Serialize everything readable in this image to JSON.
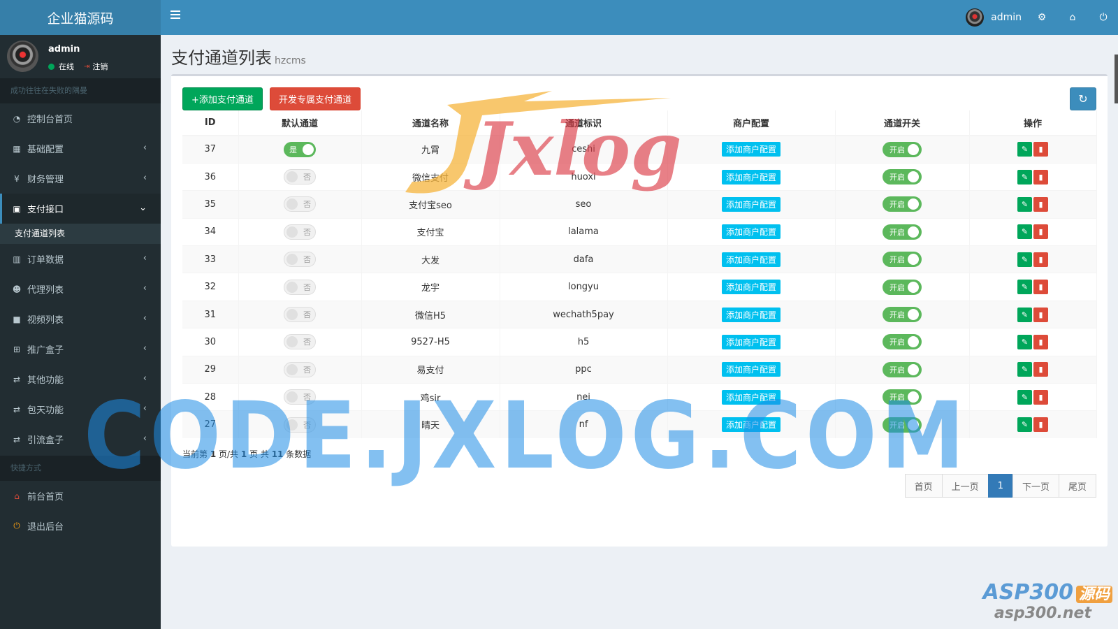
{
  "header": {
    "logo": "企业猫源码",
    "user": "admin"
  },
  "sidebar": {
    "user": {
      "name": "admin",
      "status": "在线",
      "logout": "注销"
    },
    "section1": "成功往往在失败的隅曼",
    "items": [
      {
        "label": "控制台首页",
        "icon": "dashboard-icon"
      },
      {
        "label": "基础配置",
        "icon": "grid-icon"
      },
      {
        "label": "财务管理",
        "icon": "yen-icon"
      },
      {
        "label": "支付接口",
        "icon": "payment-icon",
        "active": true
      },
      {
        "label": "订单数据",
        "icon": "bar-chart-icon"
      },
      {
        "label": "代理列表",
        "icon": "users-icon"
      },
      {
        "label": "视频列表",
        "icon": "video-icon"
      },
      {
        "label": "推广盒子",
        "icon": "table-icon"
      },
      {
        "label": "其他功能",
        "icon": "retweet-icon"
      },
      {
        "label": "包天功能",
        "icon": "retweet-icon"
      },
      {
        "label": "引流盒子",
        "icon": "retweet-icon"
      }
    ],
    "subitem": "支付通道列表",
    "section2": "快捷方式",
    "shortcuts": [
      {
        "label": "前台首页",
        "icon": "home-icon"
      },
      {
        "label": "退出后台",
        "icon": "power-icon"
      }
    ]
  },
  "page": {
    "title": "支付通道列表",
    "subtitle": "hzcms",
    "btn_add": "+添加支付通道",
    "btn_dev": "开发专属支付通道"
  },
  "table": {
    "headers": [
      "ID",
      "默认通道",
      "通道名称",
      "通道标识",
      "商户配置",
      "通道开关",
      "操作"
    ],
    "merchant_btn": "添加商户配置",
    "switch_open": "开启",
    "default_yes": "是",
    "default_no": "否",
    "rows": [
      {
        "id": "37",
        "default": true,
        "name": "九霄",
        "code": "ceshi"
      },
      {
        "id": "36",
        "default": false,
        "name": "微信支付",
        "code": "huoxi"
      },
      {
        "id": "35",
        "default": false,
        "name": "支付宝seo",
        "code": "seo"
      },
      {
        "id": "34",
        "default": false,
        "name": "支付宝",
        "code": "lalama"
      },
      {
        "id": "33",
        "default": false,
        "name": "大发",
        "code": "dafa"
      },
      {
        "id": "32",
        "default": false,
        "name": "龙宇",
        "code": "longyu"
      },
      {
        "id": "31",
        "default": false,
        "name": "微信H5",
        "code": "wechath5pay"
      },
      {
        "id": "30",
        "default": false,
        "name": "9527-H5",
        "code": "h5"
      },
      {
        "id": "29",
        "default": false,
        "name": "易支付",
        "code": "ppc"
      },
      {
        "id": "28",
        "default": false,
        "name": "鸡sir",
        "code": "nei"
      },
      {
        "id": "27",
        "default": false,
        "name": "晴天",
        "code": "nf"
      }
    ]
  },
  "pagination": {
    "info_prefix": "当前第 ",
    "current": "1",
    "info_mid": " 页/共 ",
    "total_pages": "1",
    "info_mid2": " 页 共 ",
    "total_records": "11",
    "info_suffix": " 条数据",
    "first": "首页",
    "prev": "上一页",
    "page": "1",
    "next": "下一页",
    "last": "尾页"
  },
  "watermarks": {
    "jxlog": "Jxlog",
    "code": "CODE.JXLOG.COM",
    "asp": "ASP300",
    "asp_badge": "源码",
    "asp_url": "asp300.net"
  },
  "colors": {
    "header": "#3c8dbc",
    "sidebar": "#222d32",
    "success": "#00a65a",
    "danger": "#dd4b39",
    "info": "#00c0ef"
  }
}
